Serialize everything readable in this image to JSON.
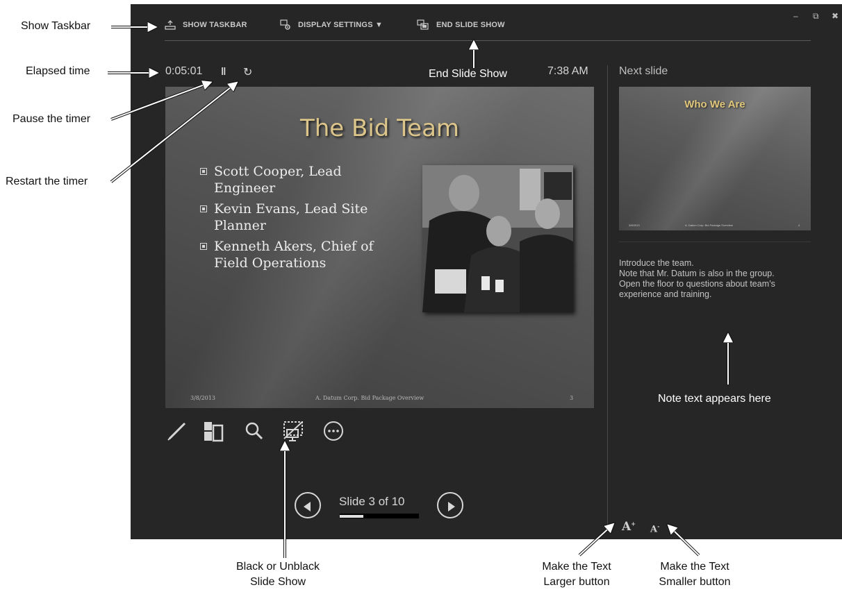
{
  "toolbar": {
    "show_taskbar": "SHOW TASKBAR",
    "display_settings": "DISPLAY SETTINGS ▼",
    "end_show": "END SLIDE SHOW"
  },
  "window_controls": {
    "minimize": "–",
    "restore": "⧉",
    "close": "✖"
  },
  "timer": {
    "elapsed": "0:05:01",
    "pause_glyph": "‖",
    "restart_glyph": "↻",
    "clock": "7:38 AM"
  },
  "current_slide": {
    "title": "The Bid Team",
    "bullets": [
      "Scott Cooper, Lead Engineer",
      "Kevin Evans, Lead Site Planner",
      "Kenneth Akers, Chief of Field Operations"
    ],
    "footer_date": "3/8/2013",
    "footer_center": "A. Datum Corp. Bid Package Overview",
    "footer_number": "3"
  },
  "tools": [
    "pen-icon",
    "see-all-slides-icon",
    "zoom-icon",
    "black-screen-icon",
    "more-options-icon"
  ],
  "navigation": {
    "slide_label": "Slide 3 of 10",
    "progress": 0.3
  },
  "next_slide": {
    "label": "Next slide",
    "title": "Who We Are",
    "footer_date": "3/8/2013",
    "footer_center": "A. Datum Corp. Bid Package Overview",
    "footer_number": "4"
  },
  "notes": {
    "lines": [
      "Introduce the team.",
      "Note that Mr. Datum is also in the group.",
      "Open the floor to questions about team’s experience and training."
    ]
  },
  "font_buttons": {
    "larger": "A",
    "smaller": "A"
  },
  "callouts": {
    "show_taskbar": "Show Taskbar",
    "elapsed_time": "Elapsed  time",
    "pause_timer": "Pause the timer",
    "restart_timer": "Restart the timer",
    "end_slide_show": "End Slide Show",
    "note_text": "Note text appears here",
    "black_unblack_1": "Black or Unblack",
    "black_unblack_2": "Slide Show",
    "larger_1": "Make the Text",
    "larger_2": "Larger button",
    "smaller_1": "Make the Text",
    "smaller_2": "Smaller button"
  },
  "colors": {
    "background": "#262626",
    "title_gold": "#dcc58a",
    "text": "#d6d6d6"
  }
}
